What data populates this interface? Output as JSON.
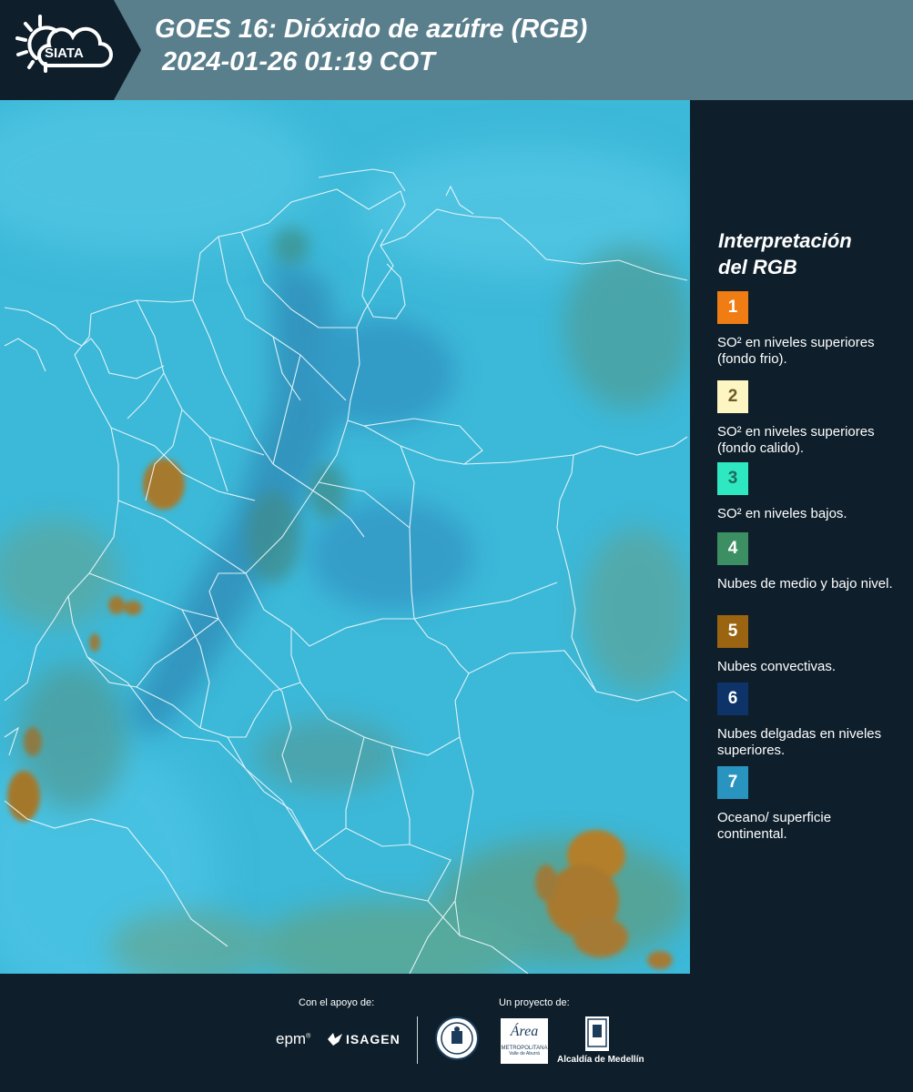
{
  "header": {
    "logo_text": "SIATA",
    "title_line1": "GOES 16: Dióxido de azúfre (RGB)",
    "title_line2": "2024-01-26 01:19 COT"
  },
  "legend": {
    "title_line1": "Interpretación",
    "title_line2": "del RGB",
    "items": [
      {
        "num": "1",
        "color": "#f07d14",
        "text_color": "#ffffff",
        "desc": "SO² en niveles superiores (fondo frio)."
      },
      {
        "num": "2",
        "color": "#fdf5c2",
        "text_color": "#6b5a2a",
        "desc": "SO² en niveles superiores (fondo calido)."
      },
      {
        "num": "3",
        "color": "#2ee8c2",
        "text_color": "#1d6b5c",
        "desc": "SO² en niveles bajos."
      },
      {
        "num": "4",
        "color": "#3c8f63",
        "text_color": "#ffffff",
        "desc": "Nubes de medio y bajo nivel."
      },
      {
        "num": "5",
        "color": "#9a6410",
        "text_color": "#ffffff",
        "desc": "Nubes convectivas."
      },
      {
        "num": "6",
        "color": "#0d3368",
        "text_color": "#ffffff",
        "desc": "Nubes delgadas en niveles superiores."
      },
      {
        "num": "7",
        "color": "#2a94c0",
        "text_color": "#ffffff",
        "desc": "Oceano/ superficie continental."
      }
    ]
  },
  "footer": {
    "support_label": "Con el apoyo de:",
    "project_label": "Un proyecto de:",
    "sponsor1": "epm",
    "sponsor2": "ISAGEN",
    "area_text1": "Área",
    "area_text2": "METROPOLITANA",
    "area_text3": "Valle de Aburrá",
    "alcaldia": "Alcaldía de Medellín"
  }
}
